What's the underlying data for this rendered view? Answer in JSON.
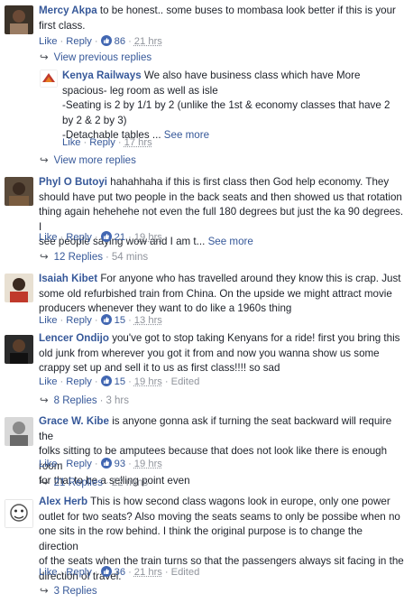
{
  "comments": [
    {
      "name": "Mercy Akpa",
      "text": "to be honest.. some buses to mombasa look better if this is your first class.",
      "like": "Like",
      "reply": "Reply",
      "likes": "86",
      "time": "21 hrs",
      "view_prev": "View previous replies",
      "reply_item": {
        "name": "Kenya Railways",
        "line1": "We also have business class which have More",
        "line2": "spacious- leg room as well as isle",
        "line3": "-Seating is 2 by 1/1 by 2 (unlike the 1st & economy classes that have 2",
        "line4": "by 2 & 2 by 3)",
        "line5": "-Detachable tables ...",
        "see_more": "See more",
        "like": "Like",
        "reply": "Reply",
        "time": "17 hrs"
      },
      "view_more": "View more replies"
    },
    {
      "name": "Phyl O Butoyi",
      "line1": "hahahhaha if this is first class then God help economy. They",
      "line2": "should have put two people in the back seats and then showed us that rotation",
      "line3": "thing again hehehehe not even the full 180 degrees but just the ka 90 degrees. I",
      "line4": "see people saying wow and I am t...",
      "see_more": "See more",
      "like": "Like",
      "reply": "Reply",
      "likes": "21",
      "time": "19 hrs",
      "replies": "12 Replies",
      "replies_time": "54 mins"
    },
    {
      "name": "Isaiah Kibet",
      "line1": "For anyone who has travelled around they know this is crap. Just",
      "line2": "some old refurbished train from China. On the upside we might attract movie",
      "line3": "producers whenever they want to do like a 1960s thing",
      "like": "Like",
      "reply": "Reply",
      "likes": "15",
      "time": "13 hrs"
    },
    {
      "name": "Lencer Ondijo",
      "line1": "you've got to stop taking Kenyans for a ride! first you bring this",
      "line2": "old junk from wherever you got it from and now you wanna show us some",
      "line3": "crappy set up and sell it to us as first class!!!! so sad",
      "like": "Like",
      "reply": "Reply",
      "likes": "15",
      "time": "19 hrs",
      "edited": "Edited",
      "replies": "8 Replies",
      "replies_time": "3 hrs"
    },
    {
      "name": "Grace W. Kibe",
      "line1": "is anyone gonna ask if turning the seat backward will require the",
      "line2": "folks sitting to be amputees because that does not look like there is enough room",
      "line3": "for that to be a selling point even",
      "like": "Like",
      "reply": "Reply",
      "likes": "93",
      "time": "19 hrs",
      "replies": "21 Replies",
      "replies_time": "22 mins"
    },
    {
      "name": "Alex Herb",
      "line1": "This is how second class wagons look in europe, only one power",
      "line2": "outlet for two seats? Also moving the seats seams to only be possibe when no",
      "line3": "one sits in the row behind. I think the original purpose is to change the direction",
      "line4": "of the seats when the train turns so that the passengers always sit facing in the",
      "line5": "direction of travel.",
      "like": "Like",
      "reply": "Reply",
      "likes": "36",
      "time": "21 hrs",
      "edited": "Edited",
      "replies": "3 Replies"
    }
  ],
  "colors": {
    "link": "#365899",
    "meta": "#90949c",
    "like_badge": "#4267b2"
  }
}
